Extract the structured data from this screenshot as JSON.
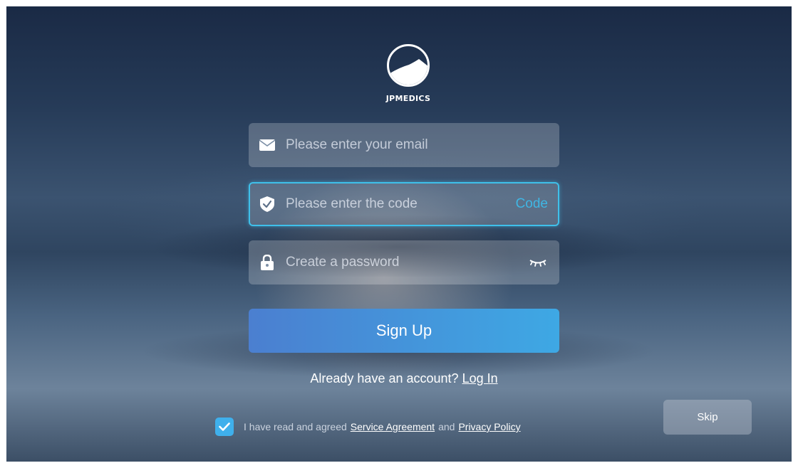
{
  "brand": {
    "name": "JPMEDICS"
  },
  "form": {
    "email": {
      "placeholder": "Please enter your email",
      "icon": "envelope-icon"
    },
    "code": {
      "placeholder": "Please enter the code",
      "icon": "shield-check-icon",
      "action_label": "Code"
    },
    "password": {
      "placeholder": "Create a password",
      "icon": "lock-icon",
      "toggle_icon": "eye-closed-icon"
    },
    "submit_label": "Sign Up"
  },
  "login": {
    "prompt": "Already have an account?",
    "link_label": "Log In"
  },
  "agreement": {
    "checked": true,
    "prefix": "I have read and agreed",
    "service_label": "Service Agreement",
    "conjunction": "and",
    "privacy_label": "Privacy Policy"
  },
  "skip_label": "Skip",
  "colors": {
    "accent": "#3fb6e4",
    "button_start": "#4b7fd0",
    "button_end": "#3ea8e4",
    "checkbox": "#3fb0ec"
  }
}
